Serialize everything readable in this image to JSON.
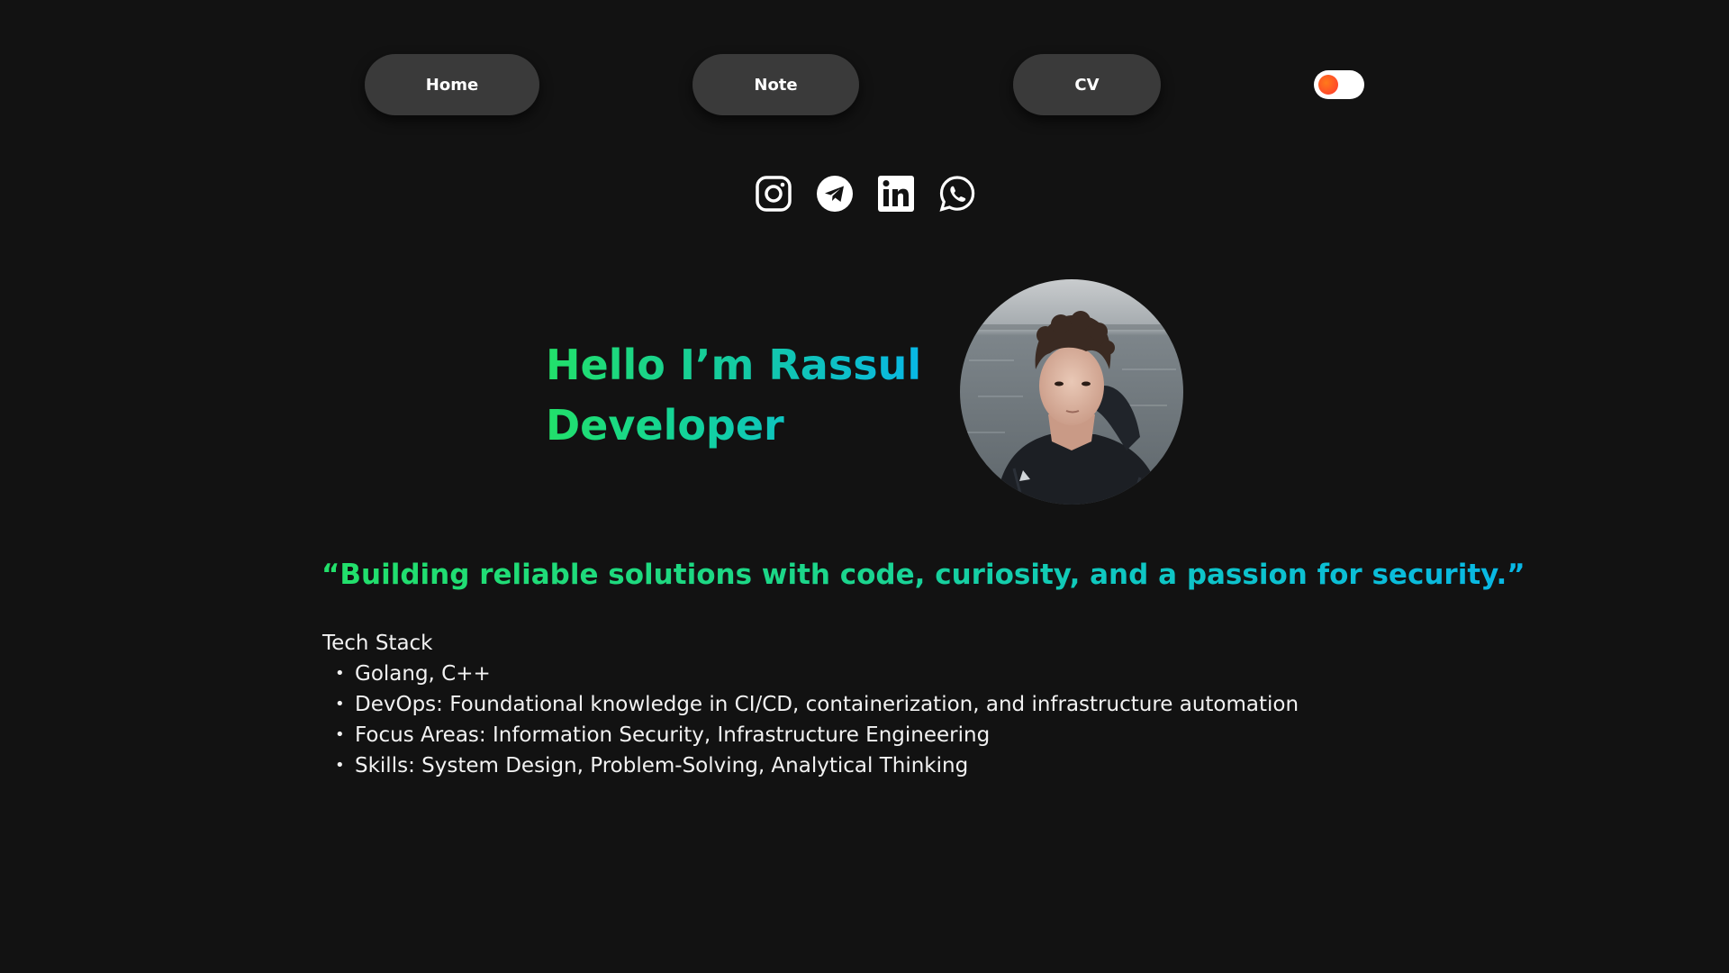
{
  "nav": {
    "home_label": "Home",
    "note_label": "Note",
    "cv_label": "CV"
  },
  "theme_toggle": {
    "state": "off",
    "knob_color": "#ff5a22"
  },
  "socials": [
    {
      "icon": "instagram-icon"
    },
    {
      "icon": "telegram-icon"
    },
    {
      "icon": "linkedin-icon"
    },
    {
      "icon": "whatsapp-icon"
    }
  ],
  "hero": {
    "line1": "Hello I’m Rassul",
    "line2": "Developer",
    "avatar": "profile-photo",
    "gradient_start": "#22e06a",
    "gradient_end": "#08b7e6"
  },
  "quote": "“Building reliable solutions with code, curiosity, and a passion for security.”",
  "tech_stack": {
    "title": "Tech Stack",
    "items": [
      "Golang, C++",
      "DevOps: Foundational knowledge in CI/CD, containerization, and infrastructure automation",
      "Focus Areas: Information Security, Infrastructure Engineering",
      "Skills: System Design, Problem-Solving, Analytical Thinking"
    ]
  },
  "colors": {
    "background": "#121212",
    "nav_button": "#3a3a3a",
    "text": "#ffffff"
  }
}
